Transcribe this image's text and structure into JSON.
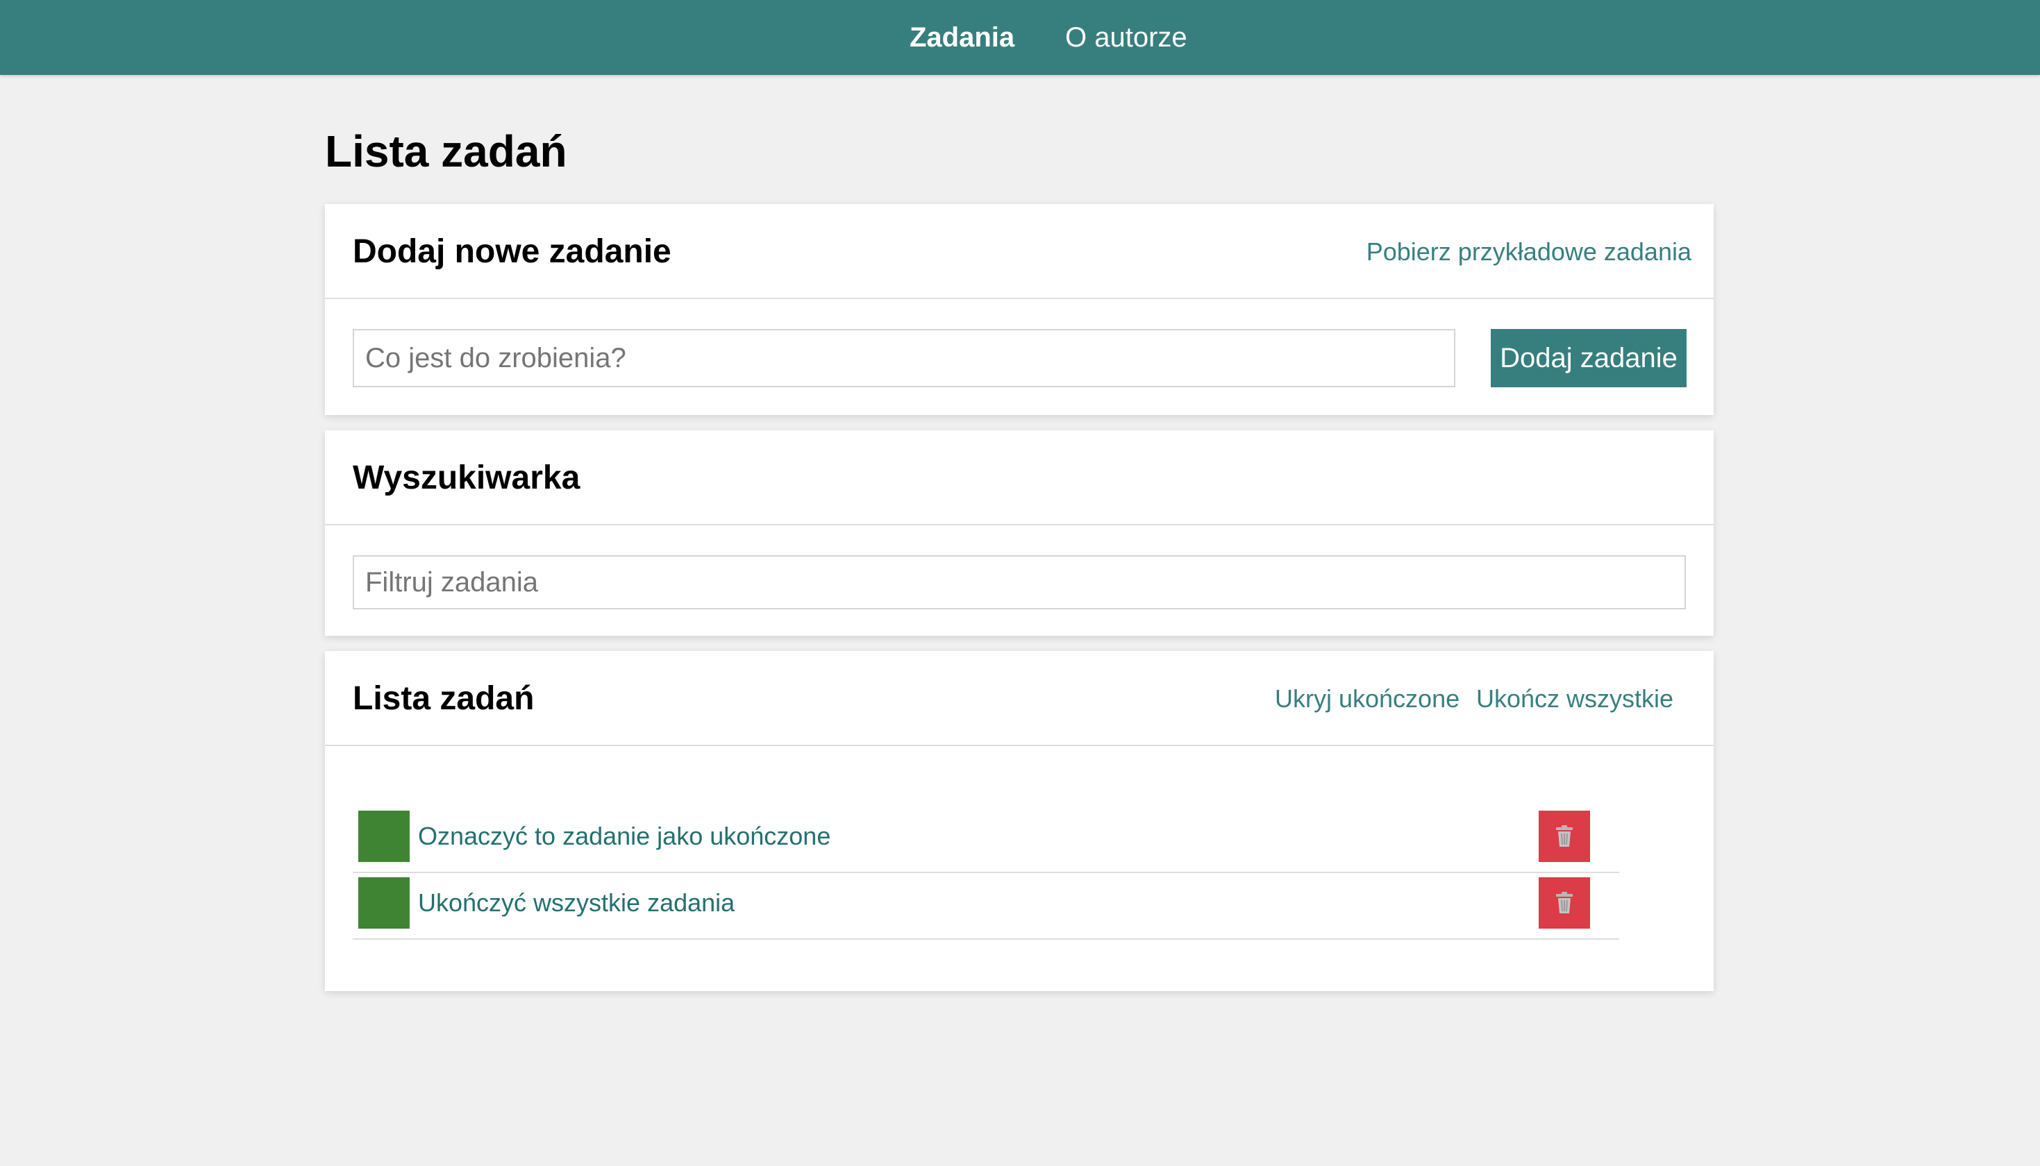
{
  "nav": {
    "items": [
      {
        "label": "Zadania",
        "active": true
      },
      {
        "label": "O autorze",
        "active": false
      }
    ]
  },
  "page": {
    "title": "Lista zadań"
  },
  "add_card": {
    "title": "Dodaj nowe zadanie",
    "examples_link": "Pobierz przykładowe zadania",
    "input_placeholder": "Co jest do zrobienia?",
    "input_value": "",
    "button_label": "Dodaj zadanie"
  },
  "search_card": {
    "title": "Wyszukiwarka",
    "input_placeholder": "Filtruj zadania",
    "input_value": ""
  },
  "list_card": {
    "title": "Lista zadań",
    "hide_completed_link": "Ukryj ukończone",
    "complete_all_link": "Ukończ wszystkie",
    "tasks": [
      {
        "label": "Oznaczyć to zadanie jako ukończone",
        "completed": false
      },
      {
        "label": "Ukończyć wszystkie zadania",
        "completed": false
      }
    ]
  },
  "colors": {
    "accent": "#377f7e",
    "task_check": "#3f8432",
    "task_delete": "#dc3c47",
    "background": "#f0f0f0"
  },
  "icons": {
    "delete": "trash-icon"
  }
}
